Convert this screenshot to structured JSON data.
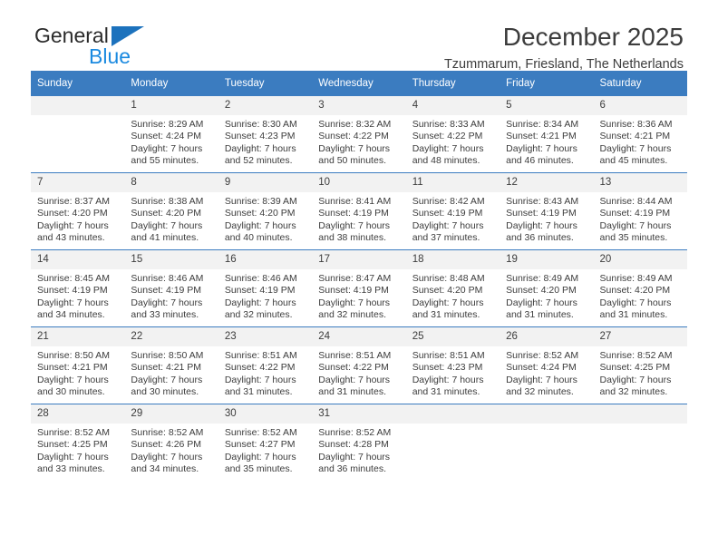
{
  "brand": {
    "name_top": "General",
    "name_bottom": "Blue",
    "triangle_color": "#1c72bd",
    "bottom_color": "#1b8ae0"
  },
  "header": {
    "title": "December 2025",
    "subtitle": "Tzummarum, Friesland, The Netherlands"
  },
  "theme": {
    "header_blue": "#3b7cc0",
    "daynum_background": "#f2f2f2",
    "text_color": "#3c3c3c"
  },
  "calendar": {
    "weekday_headers": [
      "Sunday",
      "Monday",
      "Tuesday",
      "Wednesday",
      "Thursday",
      "Friday",
      "Saturday"
    ],
    "weeks": [
      [
        {
          "day": ""
        },
        {
          "day": "1",
          "sunrise": "Sunrise: 8:29 AM",
          "sunset": "Sunset: 4:24 PM",
          "daylight": "Daylight: 7 hours and 55 minutes."
        },
        {
          "day": "2",
          "sunrise": "Sunrise: 8:30 AM",
          "sunset": "Sunset: 4:23 PM",
          "daylight": "Daylight: 7 hours and 52 minutes."
        },
        {
          "day": "3",
          "sunrise": "Sunrise: 8:32 AM",
          "sunset": "Sunset: 4:22 PM",
          "daylight": "Daylight: 7 hours and 50 minutes."
        },
        {
          "day": "4",
          "sunrise": "Sunrise: 8:33 AM",
          "sunset": "Sunset: 4:22 PM",
          "daylight": "Daylight: 7 hours and 48 minutes."
        },
        {
          "day": "5",
          "sunrise": "Sunrise: 8:34 AM",
          "sunset": "Sunset: 4:21 PM",
          "daylight": "Daylight: 7 hours and 46 minutes."
        },
        {
          "day": "6",
          "sunrise": "Sunrise: 8:36 AM",
          "sunset": "Sunset: 4:21 PM",
          "daylight": "Daylight: 7 hours and 45 minutes."
        }
      ],
      [
        {
          "day": "7",
          "sunrise": "Sunrise: 8:37 AM",
          "sunset": "Sunset: 4:20 PM",
          "daylight": "Daylight: 7 hours and 43 minutes."
        },
        {
          "day": "8",
          "sunrise": "Sunrise: 8:38 AM",
          "sunset": "Sunset: 4:20 PM",
          "daylight": "Daylight: 7 hours and 41 minutes."
        },
        {
          "day": "9",
          "sunrise": "Sunrise: 8:39 AM",
          "sunset": "Sunset: 4:20 PM",
          "daylight": "Daylight: 7 hours and 40 minutes."
        },
        {
          "day": "10",
          "sunrise": "Sunrise: 8:41 AM",
          "sunset": "Sunset: 4:19 PM",
          "daylight": "Daylight: 7 hours and 38 minutes."
        },
        {
          "day": "11",
          "sunrise": "Sunrise: 8:42 AM",
          "sunset": "Sunset: 4:19 PM",
          "daylight": "Daylight: 7 hours and 37 minutes."
        },
        {
          "day": "12",
          "sunrise": "Sunrise: 8:43 AM",
          "sunset": "Sunset: 4:19 PM",
          "daylight": "Daylight: 7 hours and 36 minutes."
        },
        {
          "day": "13",
          "sunrise": "Sunrise: 8:44 AM",
          "sunset": "Sunset: 4:19 PM",
          "daylight": "Daylight: 7 hours and 35 minutes."
        }
      ],
      [
        {
          "day": "14",
          "sunrise": "Sunrise: 8:45 AM",
          "sunset": "Sunset: 4:19 PM",
          "daylight": "Daylight: 7 hours and 34 minutes."
        },
        {
          "day": "15",
          "sunrise": "Sunrise: 8:46 AM",
          "sunset": "Sunset: 4:19 PM",
          "daylight": "Daylight: 7 hours and 33 minutes."
        },
        {
          "day": "16",
          "sunrise": "Sunrise: 8:46 AM",
          "sunset": "Sunset: 4:19 PM",
          "daylight": "Daylight: 7 hours and 32 minutes."
        },
        {
          "day": "17",
          "sunrise": "Sunrise: 8:47 AM",
          "sunset": "Sunset: 4:19 PM",
          "daylight": "Daylight: 7 hours and 32 minutes."
        },
        {
          "day": "18",
          "sunrise": "Sunrise: 8:48 AM",
          "sunset": "Sunset: 4:20 PM",
          "daylight": "Daylight: 7 hours and 31 minutes."
        },
        {
          "day": "19",
          "sunrise": "Sunrise: 8:49 AM",
          "sunset": "Sunset: 4:20 PM",
          "daylight": "Daylight: 7 hours and 31 minutes."
        },
        {
          "day": "20",
          "sunrise": "Sunrise: 8:49 AM",
          "sunset": "Sunset: 4:20 PM",
          "daylight": "Daylight: 7 hours and 31 minutes."
        }
      ],
      [
        {
          "day": "21",
          "sunrise": "Sunrise: 8:50 AM",
          "sunset": "Sunset: 4:21 PM",
          "daylight": "Daylight: 7 hours and 30 minutes."
        },
        {
          "day": "22",
          "sunrise": "Sunrise: 8:50 AM",
          "sunset": "Sunset: 4:21 PM",
          "daylight": "Daylight: 7 hours and 30 minutes."
        },
        {
          "day": "23",
          "sunrise": "Sunrise: 8:51 AM",
          "sunset": "Sunset: 4:22 PM",
          "daylight": "Daylight: 7 hours and 31 minutes."
        },
        {
          "day": "24",
          "sunrise": "Sunrise: 8:51 AM",
          "sunset": "Sunset: 4:22 PM",
          "daylight": "Daylight: 7 hours and 31 minutes."
        },
        {
          "day": "25",
          "sunrise": "Sunrise: 8:51 AM",
          "sunset": "Sunset: 4:23 PM",
          "daylight": "Daylight: 7 hours and 31 minutes."
        },
        {
          "day": "26",
          "sunrise": "Sunrise: 8:52 AM",
          "sunset": "Sunset: 4:24 PM",
          "daylight": "Daylight: 7 hours and 32 minutes."
        },
        {
          "day": "27",
          "sunrise": "Sunrise: 8:52 AM",
          "sunset": "Sunset: 4:25 PM",
          "daylight": "Daylight: 7 hours and 32 minutes."
        }
      ],
      [
        {
          "day": "28",
          "sunrise": "Sunrise: 8:52 AM",
          "sunset": "Sunset: 4:25 PM",
          "daylight": "Daylight: 7 hours and 33 minutes."
        },
        {
          "day": "29",
          "sunrise": "Sunrise: 8:52 AM",
          "sunset": "Sunset: 4:26 PM",
          "daylight": "Daylight: 7 hours and 34 minutes."
        },
        {
          "day": "30",
          "sunrise": "Sunrise: 8:52 AM",
          "sunset": "Sunset: 4:27 PM",
          "daylight": "Daylight: 7 hours and 35 minutes."
        },
        {
          "day": "31",
          "sunrise": "Sunrise: 8:52 AM",
          "sunset": "Sunset: 4:28 PM",
          "daylight": "Daylight: 7 hours and 36 minutes."
        },
        {
          "day": ""
        },
        {
          "day": ""
        },
        {
          "day": ""
        }
      ]
    ]
  }
}
